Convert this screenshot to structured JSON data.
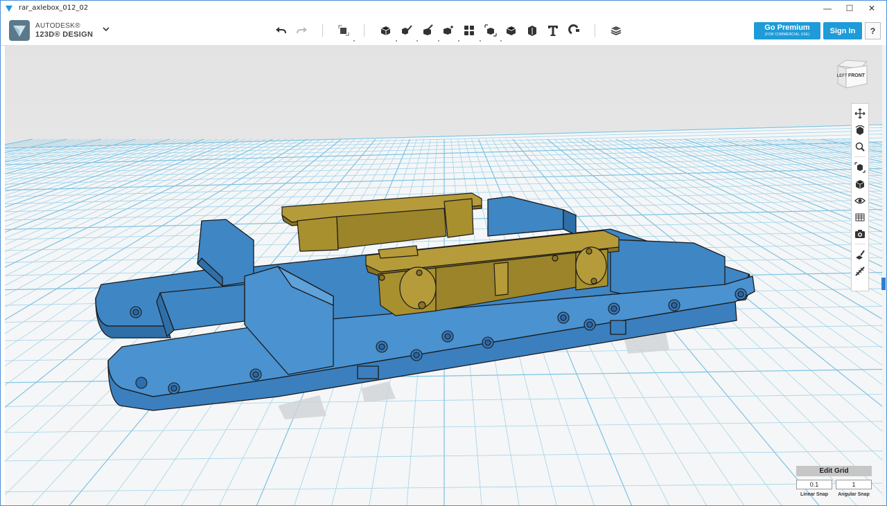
{
  "window": {
    "title": "rar_axlebox_012_02",
    "minimize": "—",
    "maximize": "☐",
    "close": "✕"
  },
  "brand": {
    "line1": "AUTODESK®",
    "line2": "123D® DESIGN"
  },
  "toolbar": {
    "icons": [
      "undo-icon",
      "redo-icon",
      "transform-icon",
      "primitives-icon",
      "sketch-icon",
      "construct-icon",
      "modify-icon",
      "pattern-icon",
      "grouping-icon",
      "combine-icon",
      "measure-icon",
      "text-icon",
      "snap-icon",
      "material-icon"
    ]
  },
  "account": {
    "premium_label": "Go Premium",
    "premium_sublabel": "(FOR COMMERCIAL USE)",
    "signin_label": "Sign In",
    "help_label": "?"
  },
  "viewcube": {
    "front_label": "FRONT",
    "left_label": "LEFT"
  },
  "navigation": {
    "items": [
      "pan-icon",
      "orbit-icon",
      "zoom-icon",
      "fit-icon",
      "view-icon",
      "visibility-icon",
      "materials-outlines-icon",
      "screenshot-icon",
      "snap-icon",
      "ruler-icon"
    ]
  },
  "grid": {
    "edit_label": "Edit Grid",
    "linear_snap_value": "0.1",
    "angular_snap_value": "1",
    "linear_snap_label": "Linear Snap",
    "angular_snap_label": "Angular Snap"
  },
  "colors": {
    "accent": "#1e9bd8",
    "frame": "#3f84c0",
    "axlebox": "#a8902f",
    "grid_line": "#88c9e6"
  }
}
